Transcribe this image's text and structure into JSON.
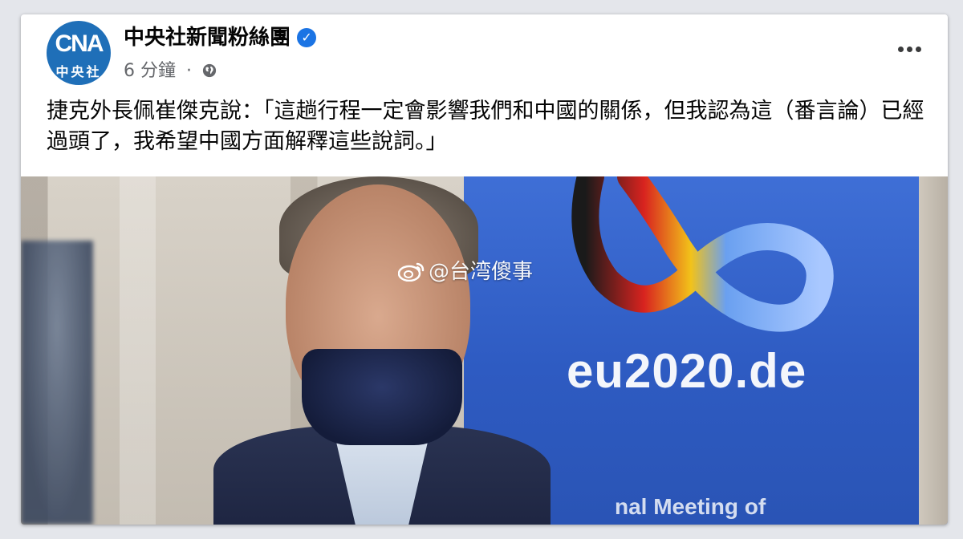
{
  "post": {
    "page_name": "中央社新聞粉絲團",
    "verified_mark": "✓",
    "time": "6 分鐘",
    "separator": "·",
    "privacy_icon": "globe-icon",
    "text": "捷克外長佩崔傑克說：「這趟行程一定會影響我們和中國的關係，但我認為這（番言論）已經過頭了，我希望中國方面解釋這些說詞。」"
  },
  "avatar": {
    "logo_text": "CNA",
    "logo_sub": "中央社"
  },
  "image": {
    "banner_text": "eu2020.de",
    "banner_subtext": "nal Meeting of",
    "watermark": "@台湾傻事",
    "watermark_icon": "weibo-icon"
  },
  "colors": {
    "verified": "#1b74e4",
    "avatar_bg": "#1f6fb8",
    "banner_blue": "#2e5bc2"
  }
}
